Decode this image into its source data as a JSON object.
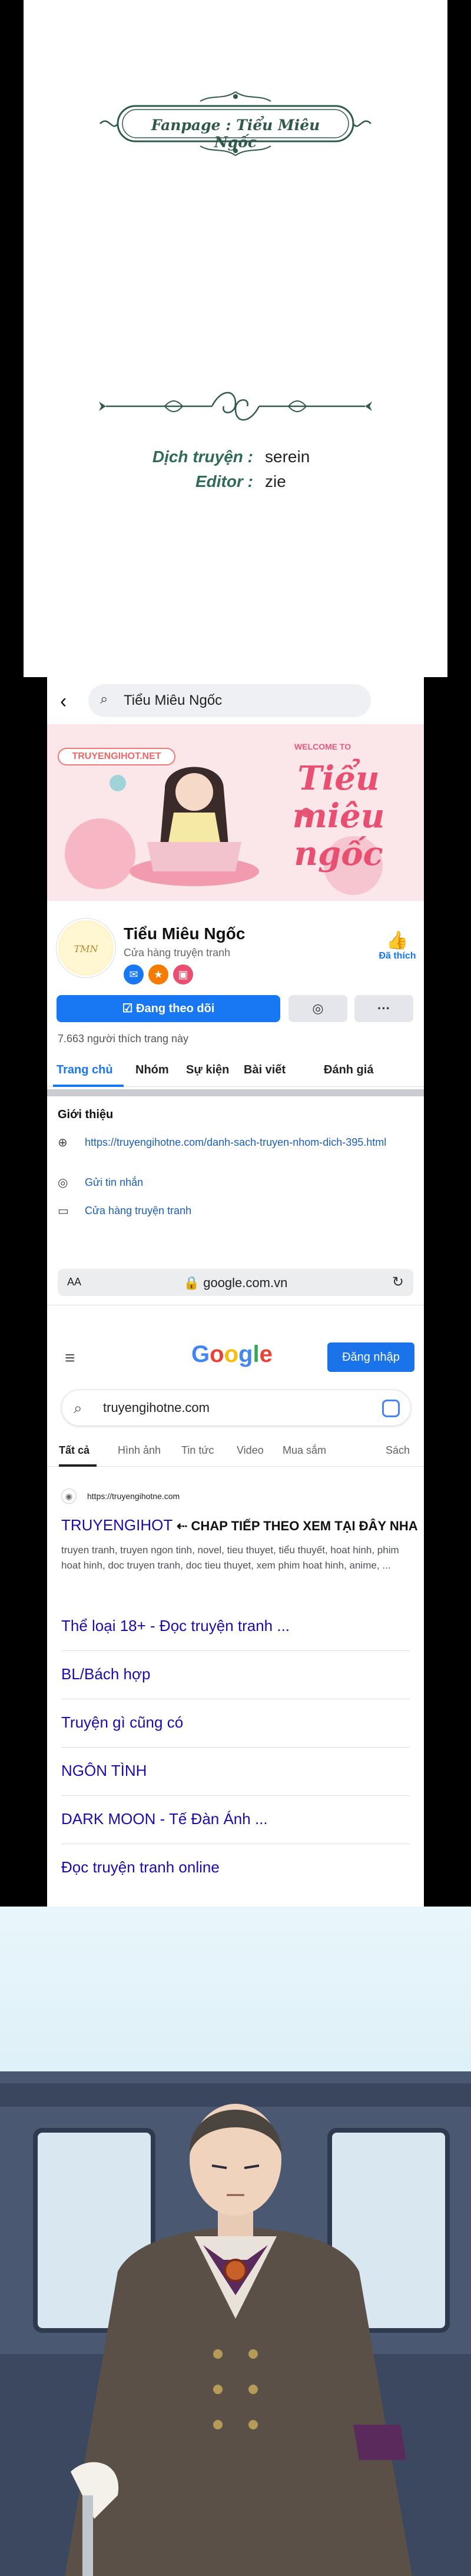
{
  "credits": {
    "fanpage_banner": "Fanpage : Tiểu Miêu Ngốc",
    "translator_label": "Dịch truyện :",
    "translator_name": "serein",
    "editor_label": "Editor :",
    "editor_name": "zie"
  },
  "facebook": {
    "search_text": "Tiểu Miêu Ngốc",
    "cover_tag": "TRUYENGIHOT.NET",
    "cover_welcome": "WELCOME TO",
    "cover_script": "Tiểu miêu ngốc",
    "page_name": "Tiểu Miêu Ngốc",
    "page_category": "Cửa hàng truyện tranh",
    "liked_label": "Đã thích",
    "follow_button": "Đang theo dõi",
    "more_label": "···",
    "likes_count": "7.663 người thích trang này",
    "tabs": [
      "Trang chủ",
      "Nhóm",
      "Sự kiện",
      "Bài viết",
      "Đánh giá"
    ],
    "intro_title": "Giới thiệu",
    "intro_link": "https://truyengihotne.com/danh-sach-truyen-nhom-dich-395.html",
    "send_message": "Gửi tin nhắn",
    "shop_link": "Cửa hàng truyện tranh"
  },
  "browser": {
    "aa_label": "AA",
    "domain": "google.com.vn",
    "lock_icon": "lock-icon",
    "reload_icon": "reload-icon"
  },
  "google": {
    "logo": "Google",
    "logo_colors": [
      "#4285F4",
      "#EA4335",
      "#FBBC05",
      "#4285F4",
      "#34A853",
      "#EA4335"
    ],
    "login_button": "Đăng nhập",
    "search_query": "truyengihotne.com",
    "tabs": [
      "Tất cả",
      "Hình ảnh",
      "Tin tức",
      "Video",
      "Mua sắm",
      "Sách"
    ],
    "result": {
      "url": "https://truyengihotne.com",
      "title": "TRUYENGIHOT",
      "callout": "⇠ CHAP TIẾP THEO XEM TẠI ĐÂY NHA",
      "snippet": "truyen tranh, truyen ngon tinh, novel, tieu thuyet, tiểu thuyết, hoat hinh, phim hoat hinh, doc truyen tranh, doc tieu thuyet, xem phim hoat hinh, anime, ...",
      "sitelinks": [
        "Thể loại 18+ - Đọc truyện tranh ...",
        "BL/Bách hợp",
        "Truyện gì cũng có",
        "NGÔN TÌNH",
        "DARK MOON - Tế Đàn Ánh ...",
        "Đọc truyện tranh online"
      ]
    }
  }
}
